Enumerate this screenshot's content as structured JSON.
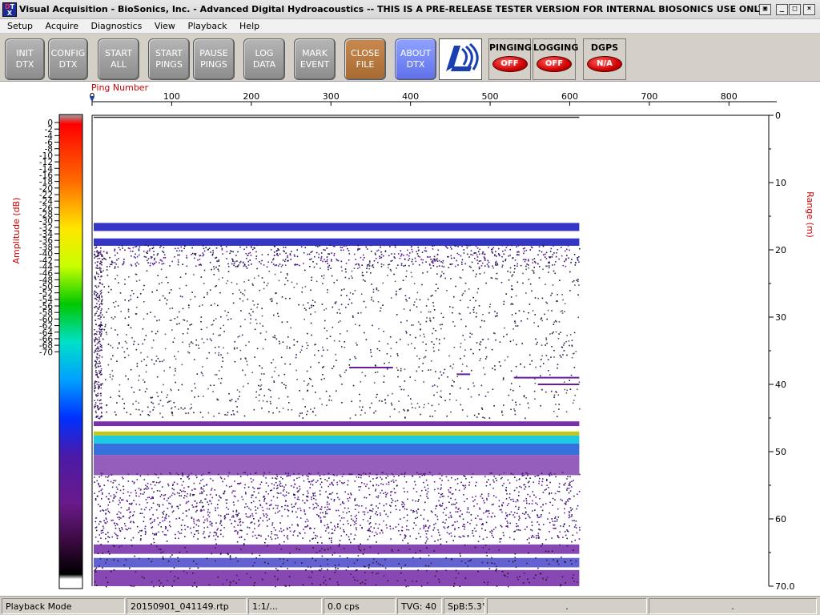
{
  "window": {
    "icon_label": "DTX",
    "title": "Visual Acquisition  -  BioSonics, Inc.  -  Advanced Digital Hydroacoustics  -- THIS IS A PRE-RELEASE TESTER VERSION FOR INTERNAL BIOSONICS USE ONLY",
    "controls": [
      "restore",
      "minimize",
      "maximize",
      "close"
    ]
  },
  "menu": [
    "Setup",
    "Acquire",
    "Diagnostics",
    "View",
    "Playback",
    "Help"
  ],
  "toolbar": {
    "buttons": [
      {
        "id": "init",
        "label": "INIT\nDTX"
      },
      {
        "id": "config",
        "label": "CONFIG\nDTX"
      },
      {
        "id": "start_all",
        "label": "START\nALL"
      },
      {
        "id": "start_pings",
        "label": "START\nPINGS"
      },
      {
        "id": "pause_pings",
        "label": "PAUSE\nPINGS"
      },
      {
        "id": "log_data",
        "label": "LOG\nDATA"
      },
      {
        "id": "mark_event",
        "label": "MARK\nEVENT"
      },
      {
        "id": "close_file",
        "label": "CLOSE\nFILE"
      },
      {
        "id": "about_dtx",
        "label": "ABOUT\nDTX"
      }
    ],
    "logo_icon": "biosonics-logo-icon",
    "indicators": [
      {
        "label": "PINGING",
        "state": "OFF",
        "color": "#d00000"
      },
      {
        "label": "LOGGING",
        "state": "OFF",
        "color": "#d00000"
      },
      {
        "label": "DGPS",
        "state": "N/A",
        "color": "#d00000"
      }
    ]
  },
  "echogram": {
    "x_axis_label": "Ping Number",
    "x_ticks": [
      "0",
      "100",
      "200",
      "300",
      "400",
      "500",
      "600",
      "700",
      "800"
    ],
    "x_range": [
      0,
      850
    ],
    "y_right_label": "Range (m)",
    "y_right_ticks": [
      "0",
      "10",
      "20",
      "30",
      "40",
      "50",
      "60",
      "70.0"
    ],
    "y_range": [
      0,
      70
    ],
    "amp_label": "Amplitude (dB)",
    "amp_ticks": [
      "0",
      "-2",
      "-4",
      "-6",
      "-8",
      "-10",
      "-12",
      "-14",
      "-16",
      "-18",
      "-20",
      "-22",
      "-24",
      "-26",
      "-28",
      "-30",
      "-32",
      "-34",
      "-36",
      "-38",
      "-40",
      "-42",
      "-44",
      "-46",
      "-48",
      "-50",
      "-52",
      "-54",
      "-56",
      "-58",
      "-60",
      "-62",
      "-64",
      "-66",
      "-68",
      "-70"
    ],
    "amp_range": [
      0,
      -70
    ],
    "data_end_ping": 612,
    "colors": {
      "axis_label": "#cc0000",
      "band_strong": "#2020c0",
      "band_weak": "#6a1aa0",
      "seabed": "#10c8e0"
    }
  },
  "statusbar": {
    "mode": "Playback Mode",
    "file": "20150901_041149.rtp",
    "ratio": "1:1/...",
    "cps": "0.0 cps",
    "tvg": "TVG: 40",
    "spb": "SpB:5.3°",
    "dot1": ".",
    "dot2": "."
  }
}
